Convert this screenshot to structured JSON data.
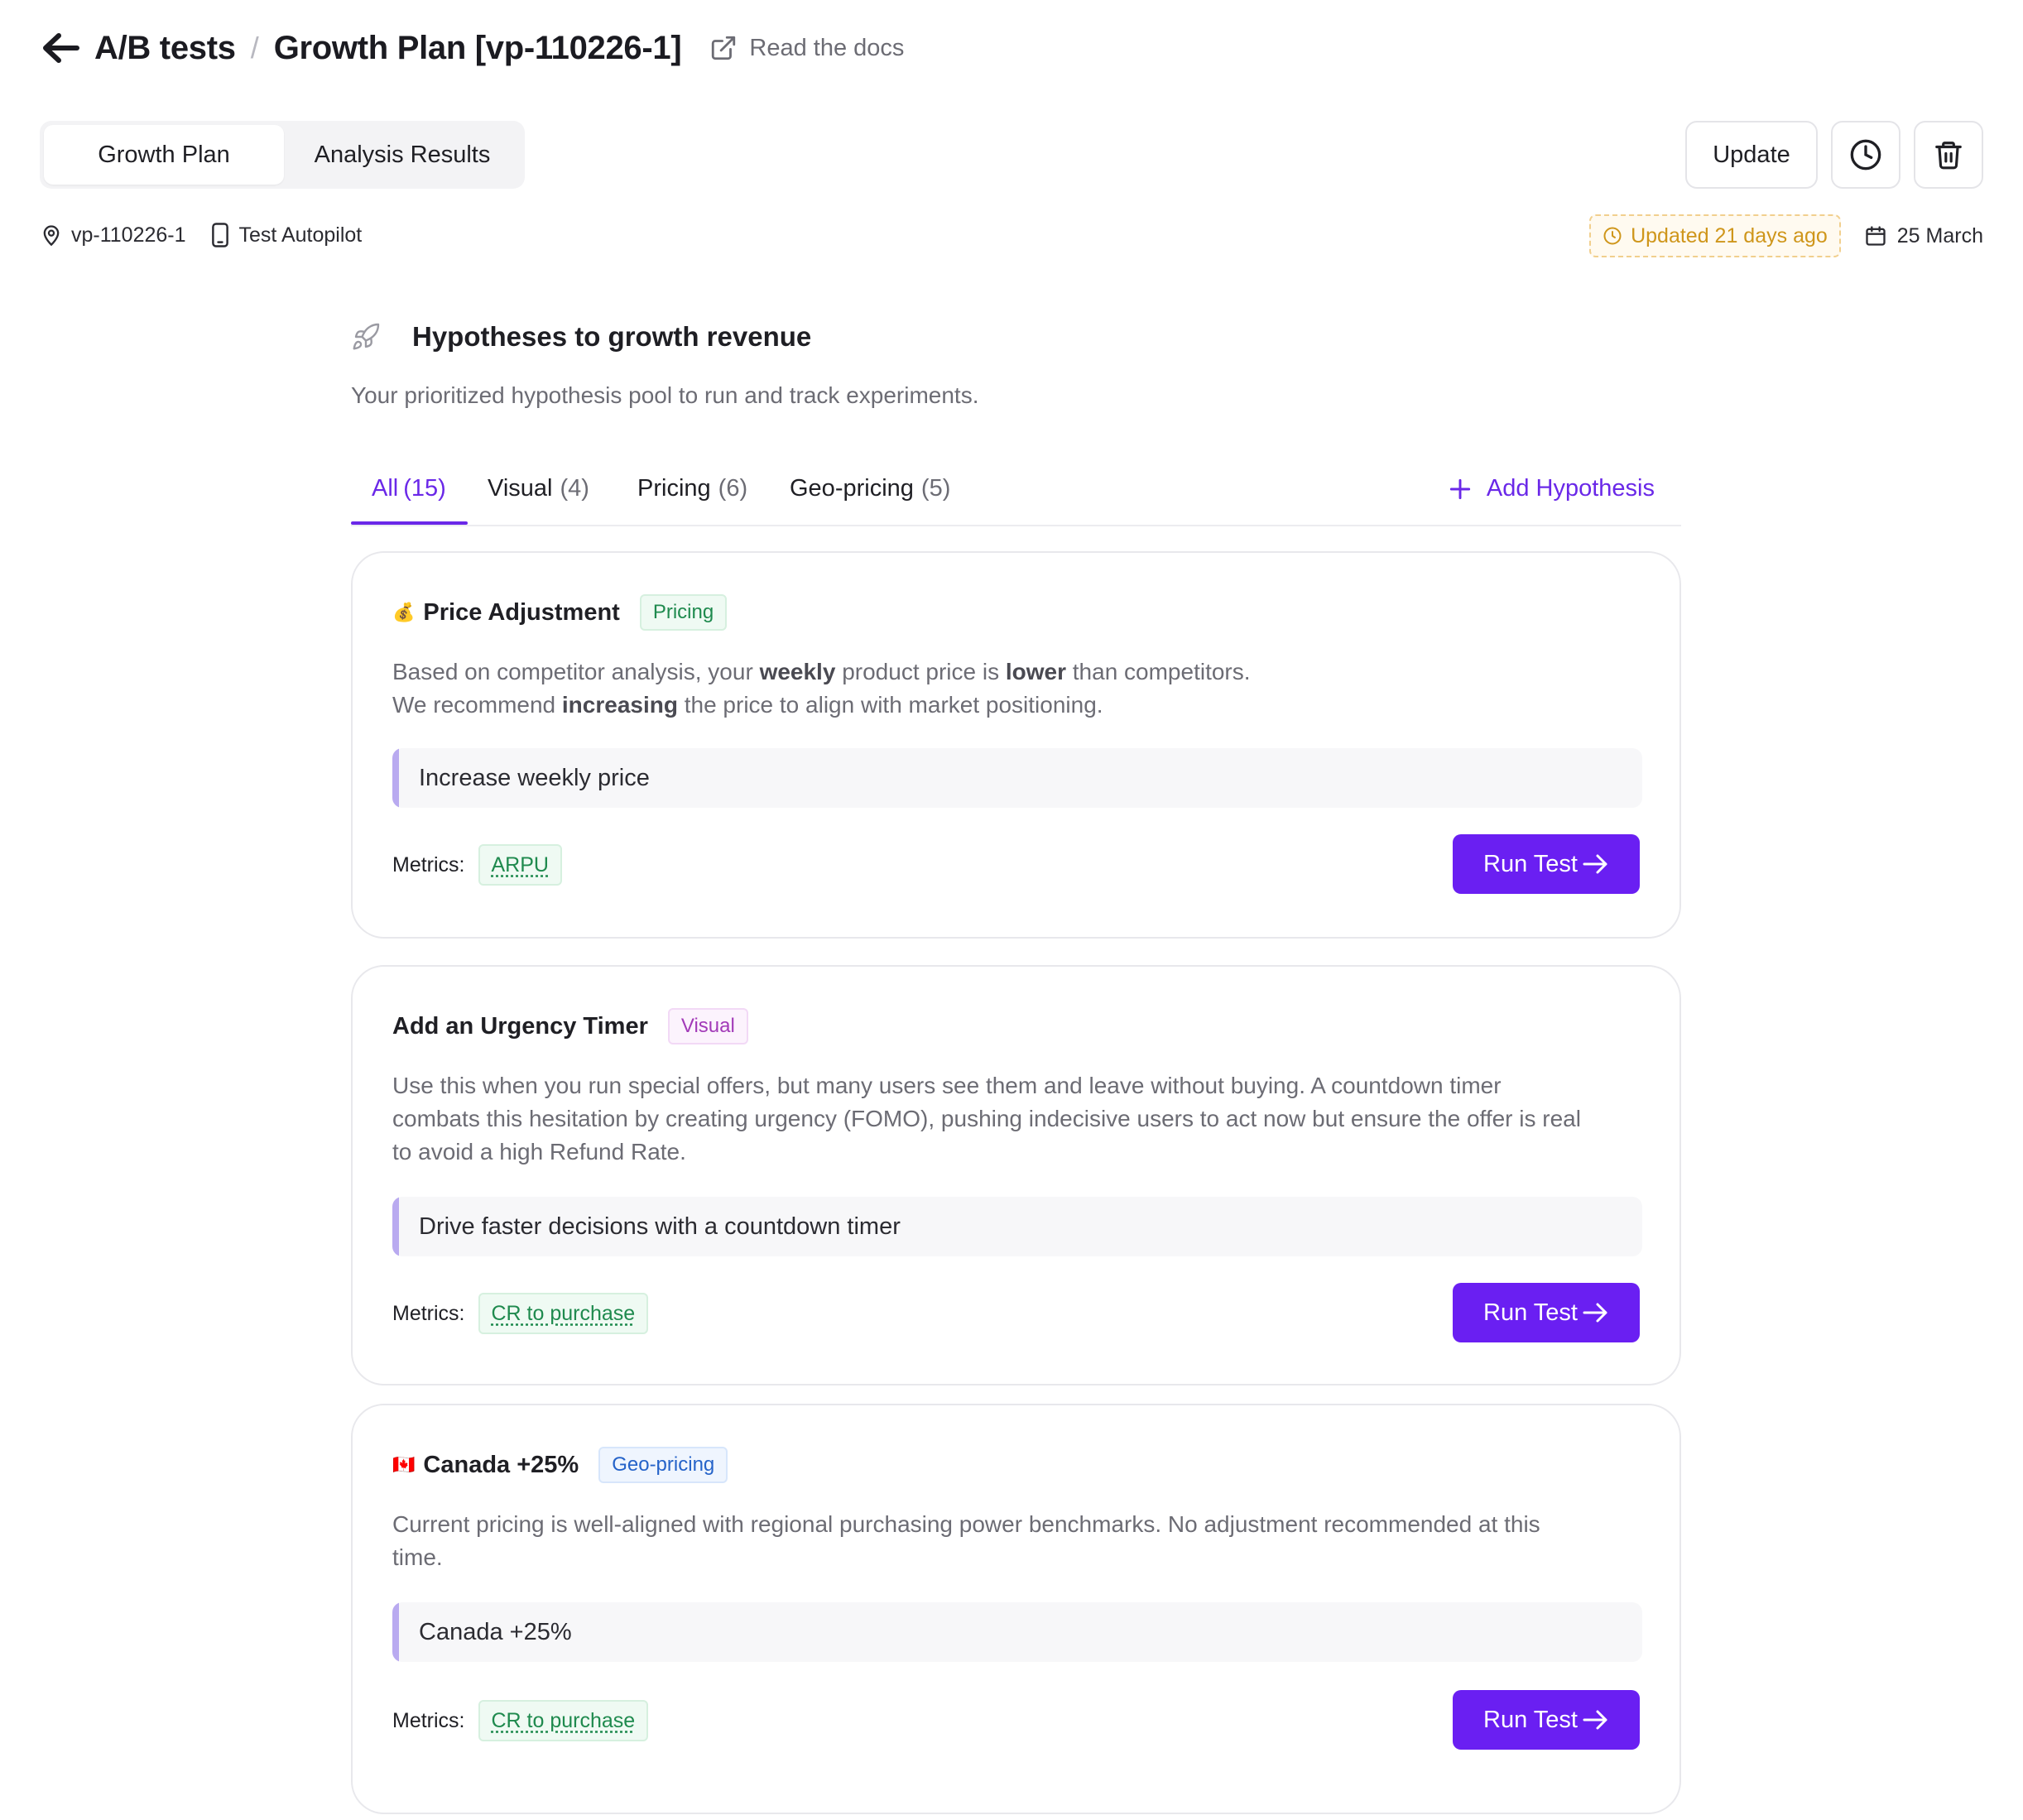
{
  "header": {
    "crumb_root": "A/B tests",
    "crumb_sep": "/",
    "crumb_current": "Growth Plan [vp-110226-1]",
    "docs_link": "Read the docs"
  },
  "view_tabs": {
    "growth_plan": "Growth Plan",
    "analysis_results": "Analysis Results"
  },
  "actions": {
    "update": "Update"
  },
  "meta": {
    "id": "vp-110226-1",
    "device": "Test Autopilot",
    "updated": "Updated 21 days ago",
    "date": "25 March"
  },
  "section": {
    "title": "Hypotheses to growth revenue",
    "subtitle": "Your prioritized hypothesis pool to run and track experiments."
  },
  "filters": {
    "tabs": [
      {
        "label": "All",
        "count": "(15)"
      },
      {
        "label": "Visual",
        "count": "(4)"
      },
      {
        "label": "Pricing",
        "count": "(6)"
      },
      {
        "label": "Geo-pricing",
        "count": "(5)"
      }
    ],
    "add_label": "Add Hypothesis"
  },
  "cards": [
    {
      "emoji": "💰",
      "title": "Price Adjustment",
      "tag": "Pricing",
      "desc_line1": [
        "Based on competitor analysis, your ",
        "weekly",
        " product price is ",
        "lower",
        " than competitors."
      ],
      "desc_line2": [
        "We recommend ",
        "increasing",
        " the price to align with market positioning."
      ],
      "quote": "Increase weekly price",
      "metrics_label": "Metrics:",
      "metric": "ARPU",
      "run_label": "Run Test"
    },
    {
      "title": "Add an Urgency Timer",
      "tag": "Visual",
      "desc": "Use this when you run special offers, but many users see them and leave without buying. A countdown timer combats this hesitation by creating urgency (FOMO), pushing indecisive users to act now but ensure the offer is real to avoid a high Refund Rate.",
      "quote": "Drive faster decisions with a countdown timer",
      "metrics_label": "Metrics:",
      "metric": "CR to purchase",
      "run_label": "Run Test"
    },
    {
      "emoji": "🇨🇦",
      "title": "Canada +25%",
      "tag": "Geo-pricing",
      "desc": "Current pricing is well-aligned with regional purchasing power benchmarks. No adjustment recommended at this time.",
      "quote": "Canada +25%",
      "metrics_label": "Metrics:",
      "metric": "CR to purchase",
      "run_label": "Run Test"
    }
  ],
  "colors": {
    "accent": "#6a1ff2",
    "tab_active": "#6a28e8",
    "pricing": "#1f8a4e",
    "visual": "#a23ab8",
    "geo": "#2563c9",
    "updated": "#cf961b"
  }
}
